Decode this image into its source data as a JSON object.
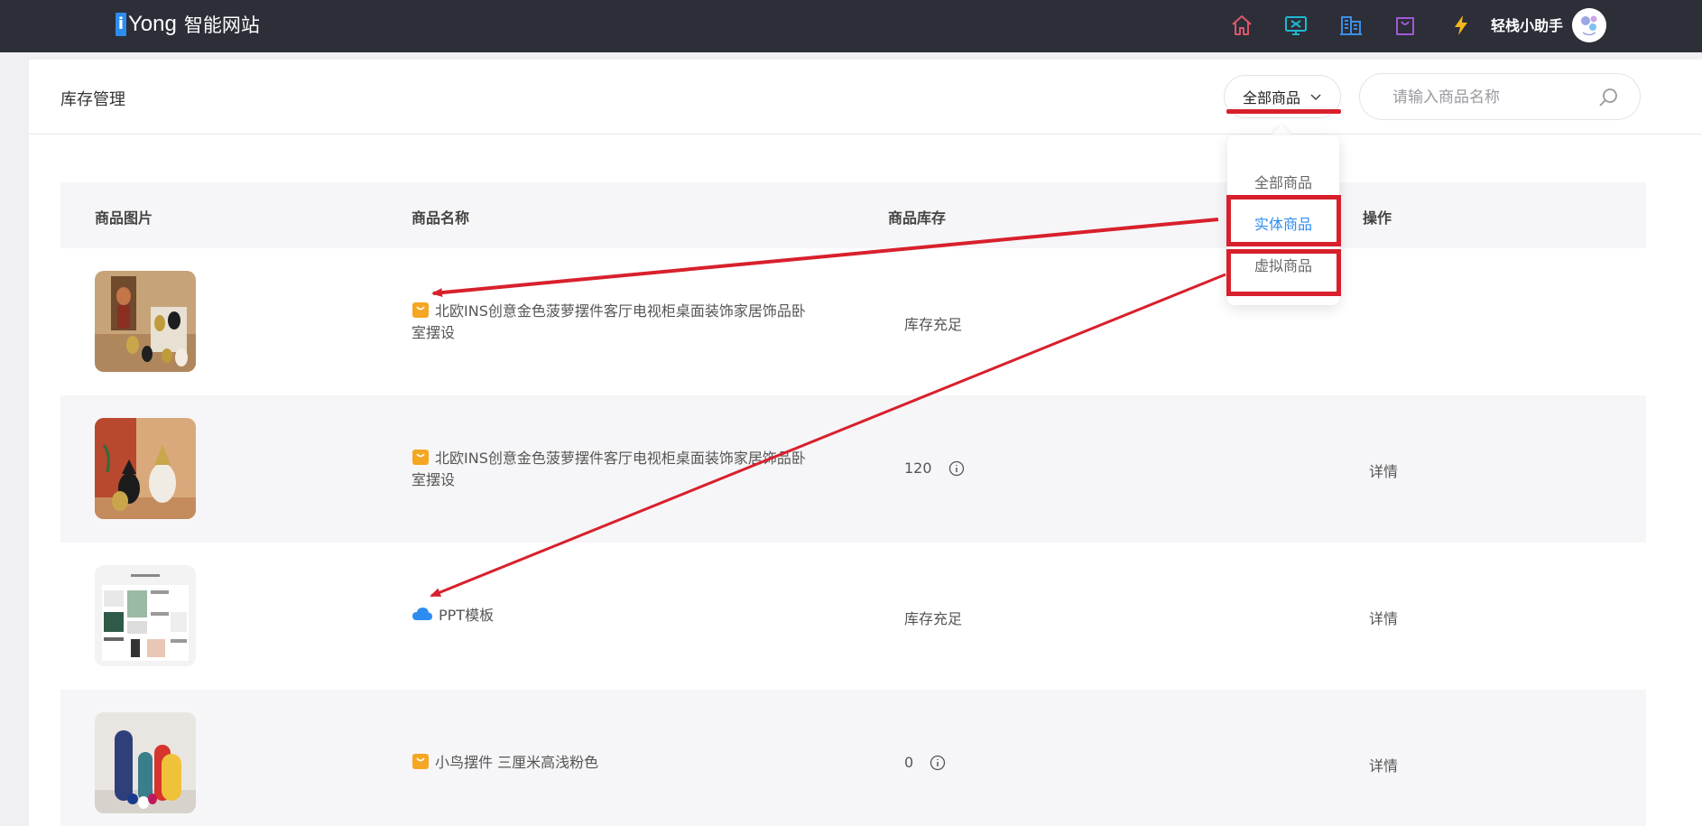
{
  "header": {
    "brand_i": "i",
    "brand_yong": "Yong",
    "brand_cn": "智能网站",
    "nav_icons": [
      "home-icon",
      "monitor-icon",
      "building-icon",
      "shopping-bag-icon",
      "lightning-icon"
    ],
    "assistant_label": "轻栈小助手",
    "colors": {
      "bar": "#2c2e38",
      "home": "#e0566a",
      "monitor": "#1fb8d0",
      "building": "#3b8fe8",
      "bag": "#a05ad6",
      "lightning": "#f5b81c"
    }
  },
  "page": {
    "title": "库存管理",
    "filter_label": "全部商品",
    "search_placeholder": "请输入商品名称"
  },
  "table": {
    "columns": [
      "商品图片",
      "商品名称",
      "商品库存",
      "操作"
    ],
    "rows": [
      {
        "name": "北欧INS创意金色菠萝摆件客厅电视柜桌面装饰家居饰品卧室摆设",
        "type_icon": "shopping-bag-icon",
        "stock": "库存充足",
        "stock_info": false,
        "action": ""
      },
      {
        "name": "北欧INS创意金色菠萝摆件客厅电视柜桌面装饰家居饰品卧室摆设",
        "type_icon": "shopping-bag-icon",
        "stock": "120",
        "stock_info": true,
        "action": "详情"
      },
      {
        "name": "PPT模板",
        "type_icon": "cloud-icon",
        "stock": "库存充足",
        "stock_info": false,
        "action": "详情"
      },
      {
        "name": "小鸟摆件 三厘米高浅粉色",
        "type_icon": "shopping-bag-icon",
        "stock": "0",
        "stock_info": true,
        "action": "详情"
      }
    ]
  },
  "dropdown": {
    "options": [
      "全部商品",
      "实体商品",
      "虚拟商品"
    ],
    "active_option": "实体商品"
  },
  "annotation_color": "#d8202c"
}
